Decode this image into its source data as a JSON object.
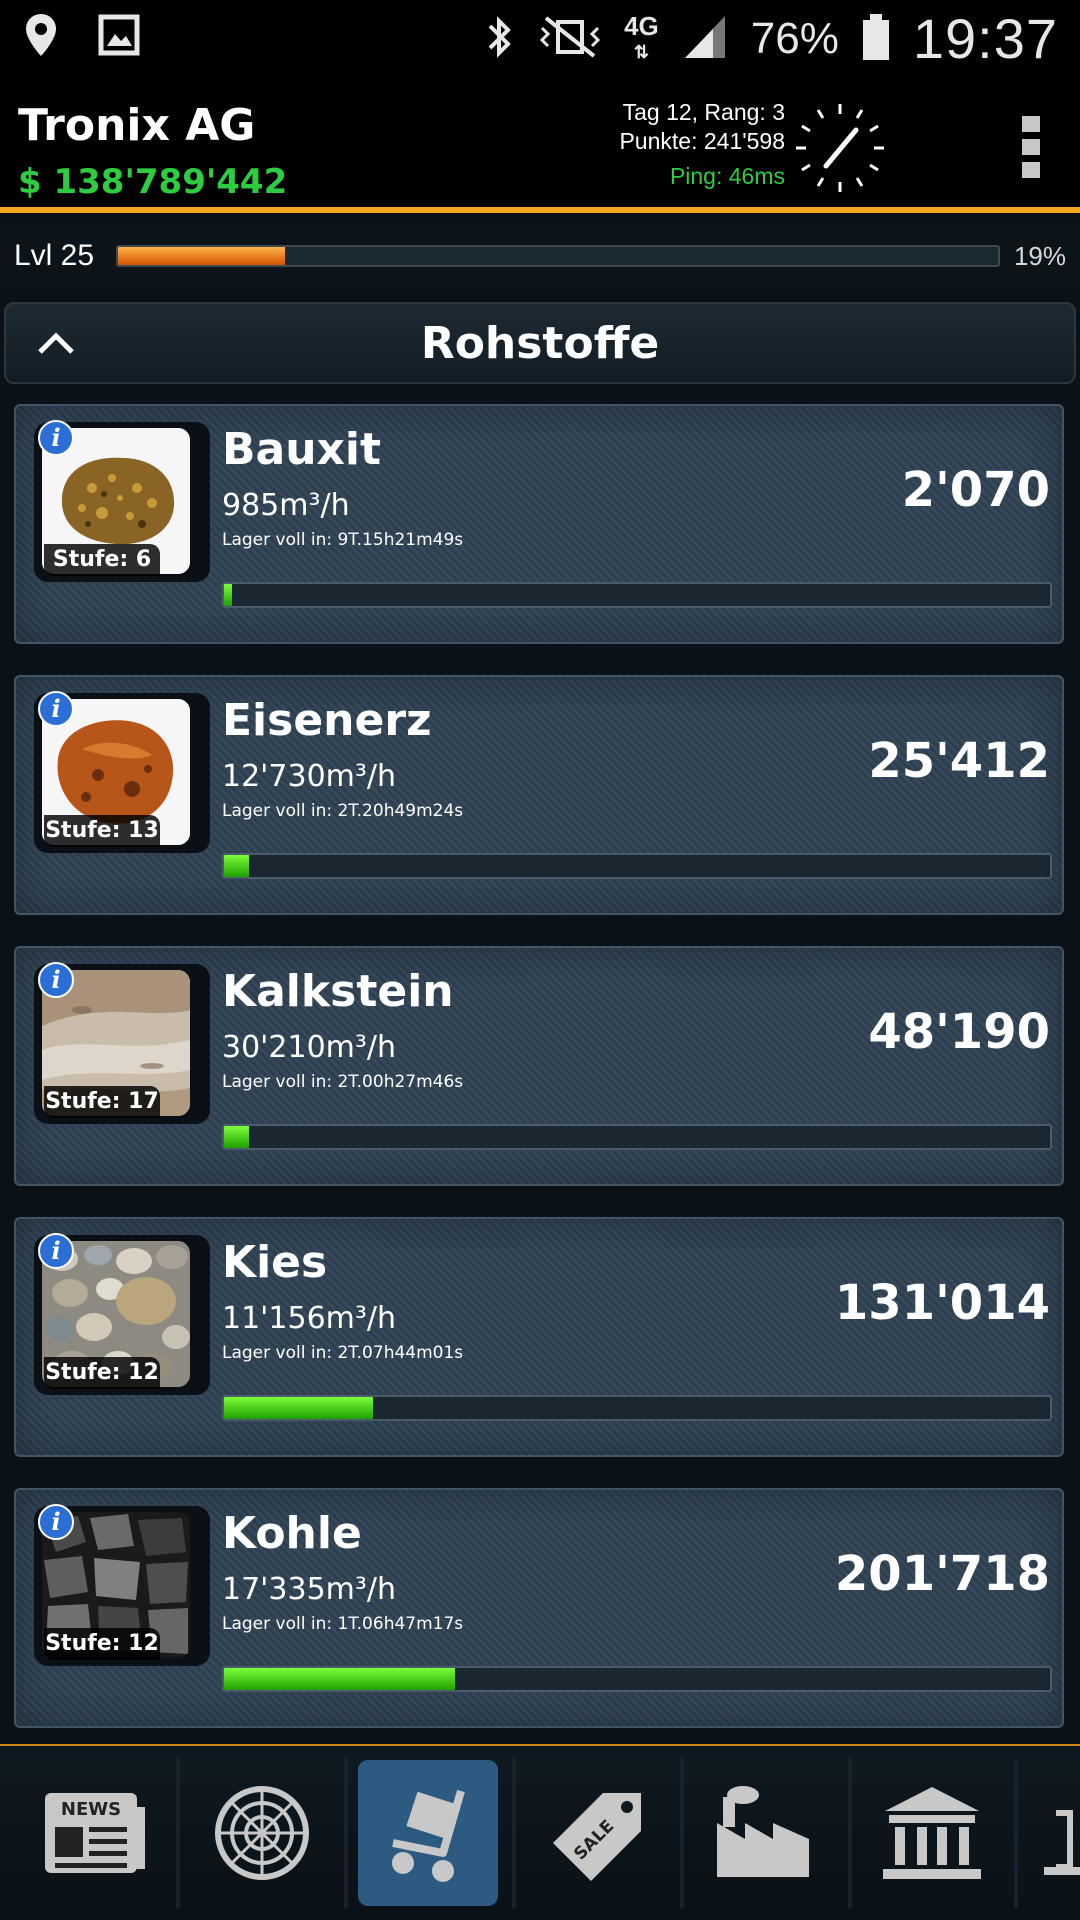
{
  "status_bar": {
    "network": "4G",
    "battery": "76%",
    "time": "19:37",
    "icons": [
      "location-icon",
      "image-icon",
      "bluetooth-icon",
      "vibrate-icon",
      "signal-icon",
      "battery-icon"
    ]
  },
  "header": {
    "company": "Tronix AG",
    "money": "$ 138'789'442",
    "day_rank": "Tag 12, Rang: 3",
    "points": "Punkte: 241'598",
    "ping": "Ping: 46ms"
  },
  "level": {
    "label": "Lvl 25",
    "percent_text": "19%",
    "progress": 0.19
  },
  "section": {
    "title": "Rohstoffe"
  },
  "resources": [
    {
      "name": "Bauxit",
      "rate": "985m³/h",
      "full": "Lager voll in: 9T.15h21m49s",
      "amount": "2'070",
      "stufe": "Stufe: 6",
      "progress": 0.01,
      "image": "bauxite-rock"
    },
    {
      "name": "Eisenerz",
      "rate": "12'730m³/h",
      "full": "Lager voll in: 2T.20h49m24s",
      "amount": "25'412",
      "stufe": "Stufe: 13",
      "progress": 0.03,
      "image": "iron-ore-rock"
    },
    {
      "name": "Kalkstein",
      "rate": "30'210m³/h",
      "full": "Lager voll in: 2T.00h27m46s",
      "amount": "48'190",
      "stufe": "Stufe: 17",
      "progress": 0.03,
      "image": "limestone"
    },
    {
      "name": "Kies",
      "rate": "11'156m³/h",
      "full": "Lager voll in: 2T.07h44m01s",
      "amount": "131'014",
      "stufe": "Stufe: 12",
      "progress": 0.18,
      "image": "gravel-pebbles"
    },
    {
      "name": "Kohle",
      "rate": "17'335m³/h",
      "full": "Lager voll in: 1T.06h47m17s",
      "amount": "201'718",
      "stufe": "Stufe: 12",
      "progress": 0.28,
      "image": "coal-lumps"
    }
  ],
  "info_badge": "i",
  "bottom_nav": {
    "news_label": "NEWS",
    "sale_label": "SALE",
    "items": [
      "news-icon",
      "radar-icon",
      "hand-truck-icon",
      "sale-tag-icon",
      "factory-icon",
      "bank-icon",
      "partial-icon"
    ],
    "active": "hand-truck-icon"
  }
}
